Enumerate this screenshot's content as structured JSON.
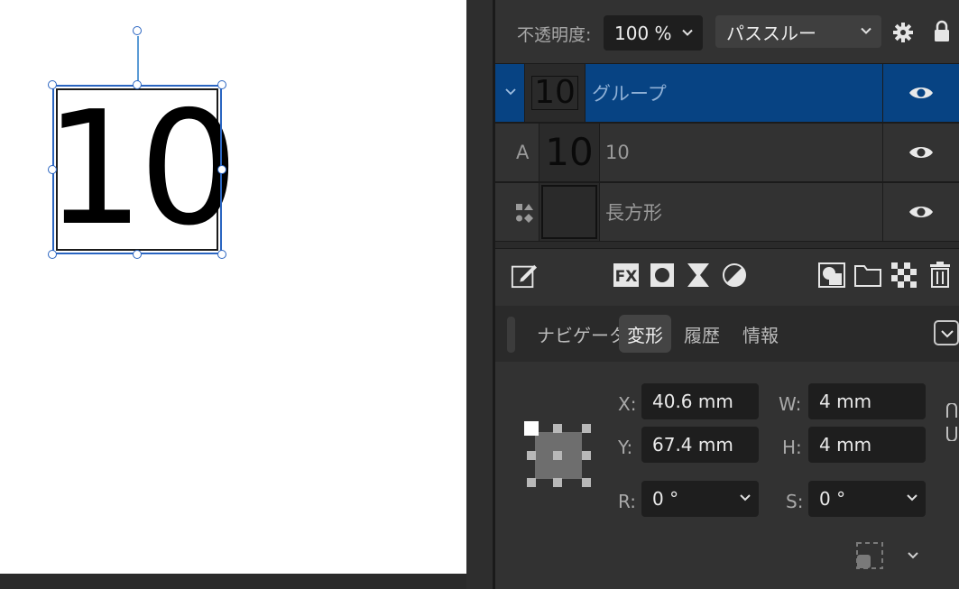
{
  "canvas": {
    "text": "10"
  },
  "opacity_bar": {
    "opacity_label": "不透明度:",
    "opacity_value": "100 %",
    "blend_mode": "パススルー",
    "settings_icon": "gear-icon",
    "lock_icon": "lock-icon"
  },
  "layers": [
    {
      "name": "グループ",
      "thumb": "10",
      "type_icon": "chevron-down-icon",
      "selected": true
    },
    {
      "name": "10",
      "thumb": "10",
      "type_label": "A",
      "selected": false
    },
    {
      "name": "長方形",
      "thumb": "",
      "type_icon": "shapes-icon",
      "selected": false
    }
  ],
  "toolbar": {
    "icons": [
      "edit-icon",
      "fx-icon",
      "mask-icon",
      "adjustment-icon",
      "contrast-icon",
      "clip-icon",
      "folder-icon",
      "checkerboard-icon",
      "trash-icon"
    ]
  },
  "tabs": {
    "navigator": "ナビゲータ",
    "transform": "変形",
    "history": "履歴",
    "info": "情報",
    "active": "変形"
  },
  "transform": {
    "x_label": "X:",
    "x_value": "40.6 mm",
    "y_label": "Y:",
    "y_value": "67.4 mm",
    "w_label": "W:",
    "w_value": "4 mm",
    "h_label": "H:",
    "h_value": "4 mm",
    "r_label": "R:",
    "r_value": "0 °",
    "s_label": "S:",
    "s_value": "0 °"
  },
  "colors": {
    "selection": "#2a65c1",
    "selected_layer": "#074383",
    "panel": "#323232",
    "field": "#1e1e1e"
  }
}
